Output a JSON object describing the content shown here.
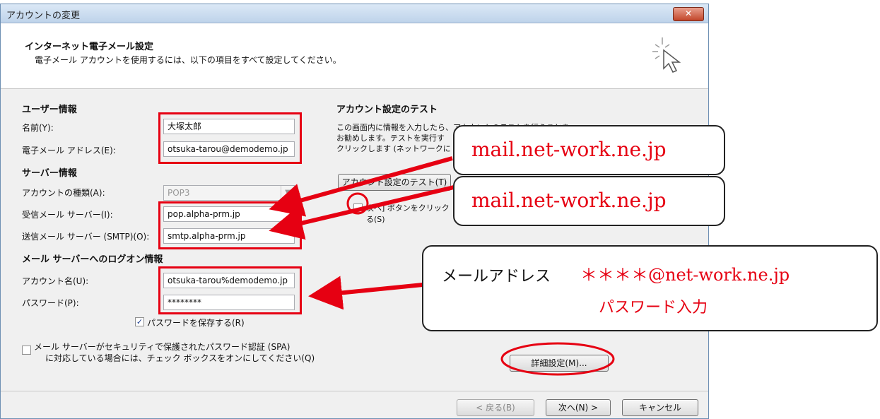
{
  "window": {
    "title": "アカウントの変更",
    "close_label": "✕"
  },
  "header": {
    "title": "インターネット電子メール設定",
    "subtitle": "電子メール アカウントを使用するには、以下の項目をすべて設定してください。"
  },
  "user_info": {
    "section_label": "ユーザー情報",
    "name_label": "名前(Y):",
    "name_value": "大塚太郎",
    "email_label": "電子メール アドレス(E):",
    "email_value": "otsuka-tarou@demodemo.jp"
  },
  "server_info": {
    "section_label": "サーバー情報",
    "account_type_label": "アカウントの種類(A):",
    "account_type_value": "POP3",
    "incoming_label": "受信メール サーバー(I):",
    "incoming_value": "pop.alpha-prm.jp",
    "outgoing_label": "送信メール サーバー (SMTP)(O):",
    "outgoing_value": "smtp.alpha-prm.jp"
  },
  "logon_info": {
    "section_label": "メール サーバーへのログオン情報",
    "account_name_label": "アカウント名(U):",
    "account_name_value": "otsuka-tarou%demodemo.jp",
    "password_label": "パスワード(P):",
    "password_value": "********",
    "save_password_label": "パスワードを保存する(R)",
    "save_password_checked": true,
    "spa_label_line1": "メール サーバーがセキュリティで保護されたパスワード認証 (SPA)",
    "spa_label_line2": "に対応している場合には、チェック ボックスをオンにしてください(Q)"
  },
  "test_section": {
    "section_label": "アカウント設定のテスト",
    "desc_line1": "この画面内に情報を入力したら、アカウントのテストを行うことを",
    "desc_line2": "お勧めします。テストを実行す",
    "desc_line3": "クリックします (ネットワークに",
    "test_button_label": "アカウント設定のテスト(T)",
    "next_test_label": "次へ] ボタンをクリック",
    "next_test_label2": "る(S)"
  },
  "buttons": {
    "advanced": "詳細設定(M)...",
    "back": "< 戻る(B)",
    "next": "次へ(N) >",
    "cancel": "キャンセル"
  },
  "annotations": {
    "incoming_server": "mail.net-work.ne.jp",
    "outgoing_server": "mail.net-work.ne.jp",
    "account_prefix": "メールアドレス",
    "account_value": "＊＊＊＊@net-work.ne.jp",
    "password_note": "パスワード入力"
  },
  "colors": {
    "annotation_red": "#e60012"
  }
}
